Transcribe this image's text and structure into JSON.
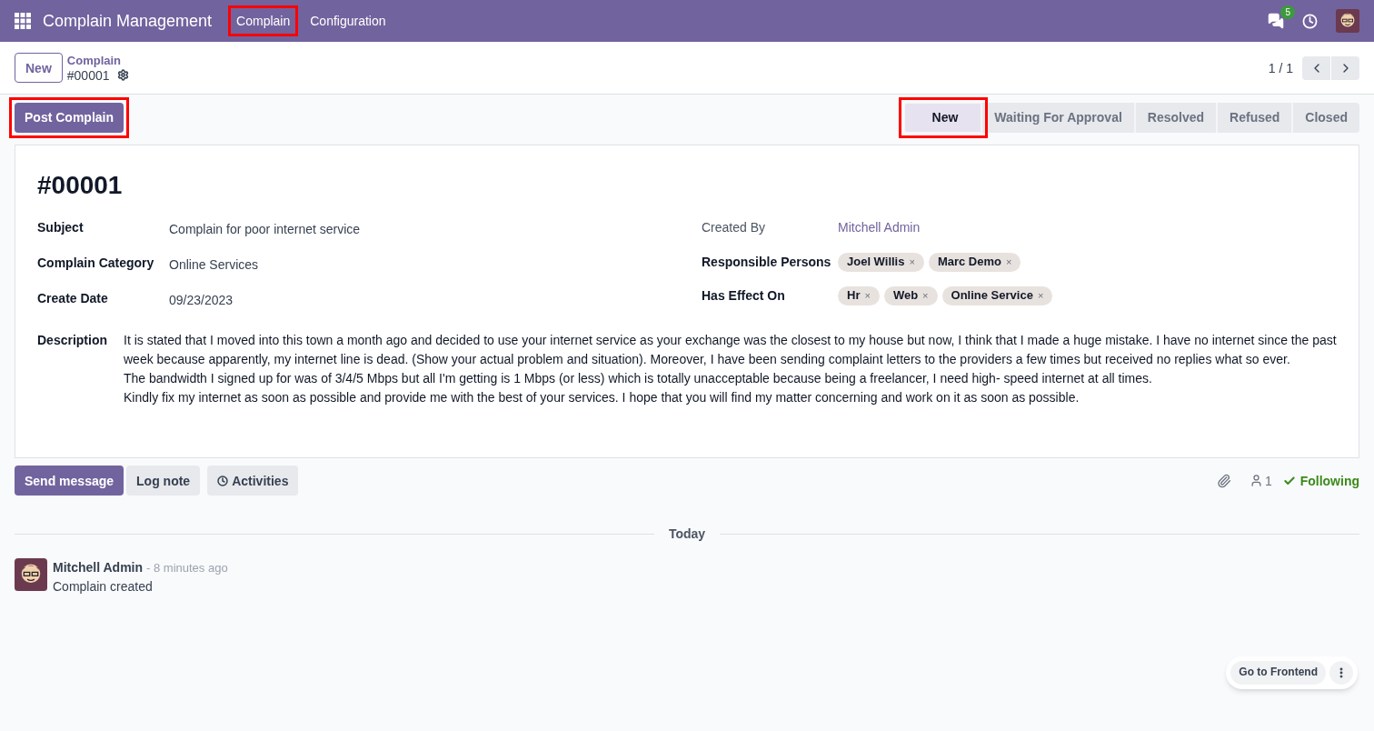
{
  "navbar": {
    "app_title": "Complain Management",
    "menu": [
      {
        "label": "Complain",
        "highlighted": true
      },
      {
        "label": "Configuration",
        "highlighted": false
      }
    ],
    "message_count": "5"
  },
  "control_panel": {
    "new_button": "New",
    "breadcrumb": "Complain",
    "record": "#00001",
    "pager": "1 / 1"
  },
  "status_bar": {
    "action": {
      "label": "Post Complain",
      "highlighted": true
    },
    "stages": [
      {
        "label": "New",
        "selected": true,
        "highlighted": true
      },
      {
        "label": "Waiting For Approval",
        "selected": false,
        "highlighted": false
      },
      {
        "label": "Resolved",
        "selected": false,
        "highlighted": false
      },
      {
        "label": "Refused",
        "selected": false,
        "highlighted": false
      },
      {
        "label": "Closed",
        "selected": false,
        "highlighted": false
      }
    ]
  },
  "form": {
    "title": "#00001",
    "left_fields": [
      {
        "label": "Subject",
        "value": "Complain for poor internet service"
      },
      {
        "label": "Complain Category",
        "value": "Online Services"
      },
      {
        "label": "Create Date",
        "value": "09/23/2023"
      }
    ],
    "created_by": {
      "label": "Created By",
      "value": "Mitchell Admin"
    },
    "tag_fields": [
      {
        "label": "Responsible Persons",
        "tags": [
          {
            "label": "Joel Willis",
            "remove": "×"
          },
          {
            "label": "Marc Demo",
            "remove": "×"
          }
        ]
      },
      {
        "label": "Has Effect On",
        "tags": [
          {
            "label": "Hr",
            "remove": "×"
          },
          {
            "label": "Web",
            "remove": "×"
          },
          {
            "label": "Online Service",
            "remove": "×"
          }
        ]
      }
    ],
    "description": {
      "label": "Description",
      "paragraphs": [
        "It is stated that I moved into this town a month ago and decided to use your internet service as your exchange was the closest to my house but now, I think that I made a huge mistake. I have no internet since the past week because apparently, my internet line is dead. (Show your actual problem and situation). Moreover, I have been sending complaint letters to the providers a few times but received no replies what so ever.",
        "The bandwidth I signed up for was of 3/4/5 Mbps but all I'm getting is 1 Mbps (or less) which is totally unacceptable because being a freelancer, I need high- speed internet at all times.",
        "Kindly fix my internet as soon as possible and provide me with the best of your services. I hope that you will find my matter concerning and work on it as soon as possible."
      ]
    }
  },
  "chatter": {
    "buttons": [
      {
        "label": "Send message",
        "kind": "primary"
      },
      {
        "label": "Log note",
        "kind": "secondary"
      },
      {
        "label": "Activities",
        "kind": "activities"
      }
    ],
    "followers": "1",
    "following": "Following",
    "divider": "Today",
    "messages": [
      {
        "author": "Mitchell Admin",
        "time": "- 8 minutes ago",
        "body": "Complain created"
      }
    ]
  },
  "floating": {
    "label": "Go to Frontend"
  }
}
